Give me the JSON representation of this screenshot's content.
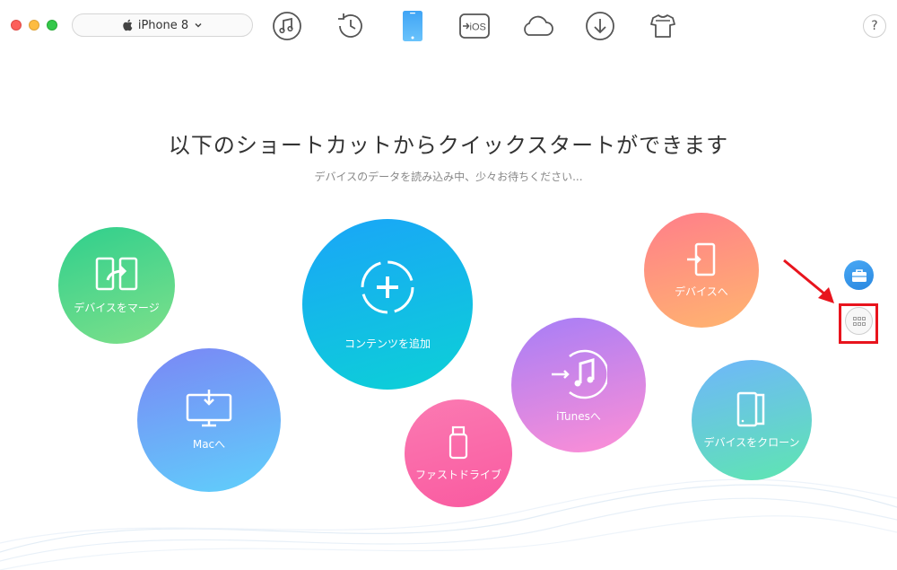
{
  "window": {
    "traffic_lights": [
      "close",
      "minimize",
      "maximize"
    ]
  },
  "device_selector": {
    "label": "iPhone 8",
    "icon": "apple-icon"
  },
  "toolbar": {
    "items": [
      {
        "name": "music-icon"
      },
      {
        "name": "history-icon"
      },
      {
        "name": "phone-icon",
        "active": true
      },
      {
        "name": "ios-transfer-icon",
        "label": "iOS"
      },
      {
        "name": "cloud-icon"
      },
      {
        "name": "download-icon"
      },
      {
        "name": "tshirt-icon"
      }
    ],
    "help_label": "?"
  },
  "main": {
    "headline": "以下のショートカットからクイックスタートができます",
    "subline": "デバイスのデータを読み込み中、少々お待ちください..."
  },
  "shortcuts": {
    "merge": {
      "label": "デバイスをマージ",
      "icon": "merge-icon"
    },
    "add": {
      "label": "コンテンツを追加",
      "icon": "plus-icon"
    },
    "to_device": {
      "label": "デバイスへ",
      "icon": "to-device-icon"
    },
    "to_mac": {
      "label": "Macへ",
      "icon": "monitor-download-icon"
    },
    "fast_drive": {
      "label": "ファストドライブ",
      "icon": "usb-drive-icon"
    },
    "to_itunes": {
      "label": "iTunesへ",
      "icon": "itunes-icon"
    },
    "clone": {
      "label": "デバイスをクローン",
      "icon": "clone-icon"
    }
  },
  "side_buttons": [
    {
      "name": "briefcase-icon"
    },
    {
      "name": "app-grid-icon",
      "highlighted": true
    }
  ],
  "colors": {
    "highlight": "#e8141d",
    "merge": "#2fcf8d",
    "add": "#1aa5f8",
    "to_device": "#ff7e8a",
    "to_mac": "#7b86f5",
    "fast_drive": "#fb7ab2",
    "to_itunes": "#a67ef7",
    "clone": "#6fb6fb"
  }
}
